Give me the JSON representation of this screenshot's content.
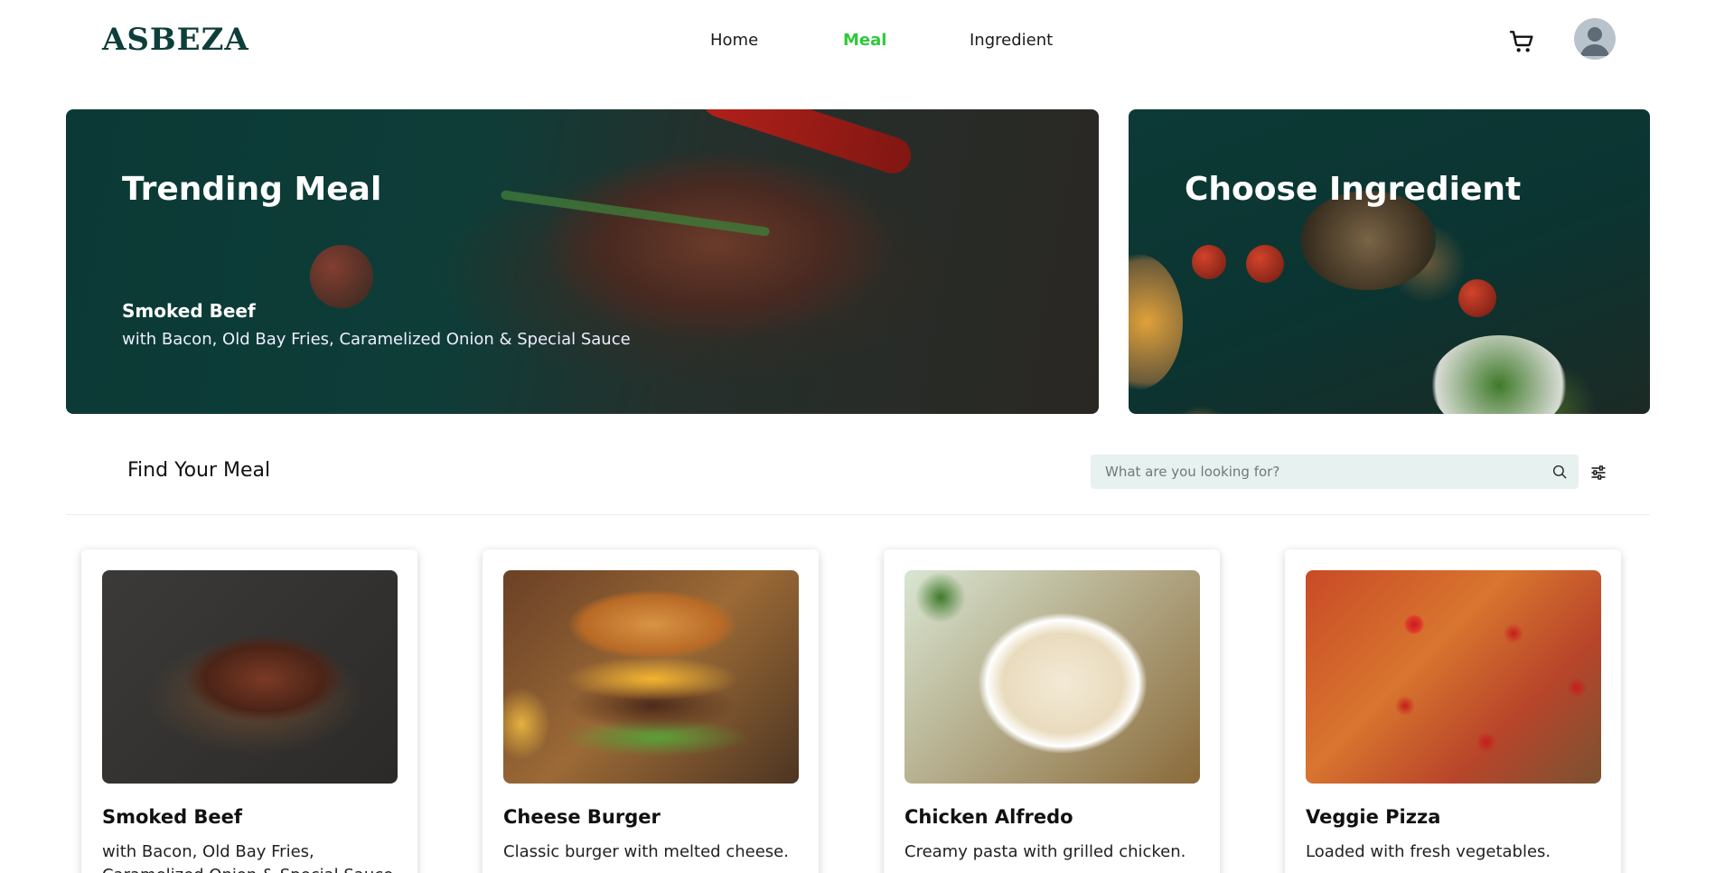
{
  "nav": {
    "logo": "ASBEZA",
    "links": [
      {
        "label": "Home",
        "active": false
      },
      {
        "label": "Meal",
        "active": true
      },
      {
        "label": "Ingredient",
        "active": false
      }
    ],
    "cart_icon": "cart-icon",
    "avatar_icon": "user-avatar-icon"
  },
  "hero": {
    "trending": {
      "title": "Trending Meal",
      "meal_name": "Smoked Beef",
      "meal_desc": "with Bacon, Old Bay Fries, Caramelized Onion & Special Sauce"
    },
    "ingredient": {
      "title": "Choose Ingredient"
    }
  },
  "search": {
    "title": "Find Your Meal",
    "placeholder": "What are you looking for?",
    "search_icon": "search-icon",
    "filter_icon": "filter-sliders-icon"
  },
  "meals": [
    {
      "name": "Smoked Beef",
      "desc": "with Bacon, Old Bay Fries, Caramelized Onion & Special Sauce"
    },
    {
      "name": "Cheese Burger",
      "desc": "Classic burger with melted cheese."
    },
    {
      "name": "Chicken Alfredo",
      "desc": "Creamy pasta with grilled chicken."
    },
    {
      "name": "Veggie Pizza",
      "desc": "Loaded with fresh vegetables."
    }
  ],
  "colors": {
    "brand": "#0d3f3a",
    "accent": "#2ec93a",
    "search_bg": "#e6f1f0"
  }
}
